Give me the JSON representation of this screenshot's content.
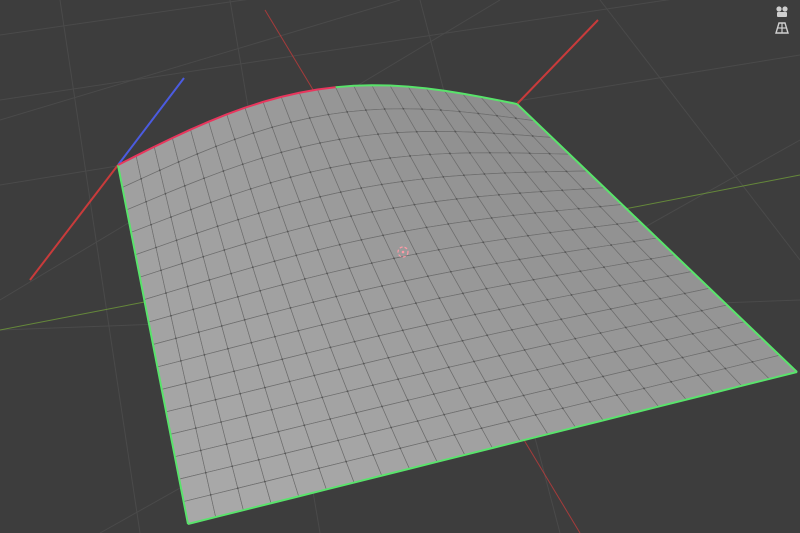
{
  "viewport": {
    "background": "#3d3d3d",
    "grid_color": "#4a4a4a",
    "axis_x_color": "#c83b3b",
    "axis_y_color": "#6f9b3a",
    "axis_z_color": "#4b5be0",
    "mesh_fill": "#9d9d9d",
    "mesh_wire": "#6e6e6e",
    "selected_edge_color": "#59e36b",
    "active_edge_color": "#e8365d",
    "pivot_color": "#ff9aa6"
  },
  "mesh": {
    "object_type": "plane",
    "subdivisions_u": 22,
    "subdivisions_v": 16,
    "selection_mode": "edge"
  },
  "navigation": {
    "icons": [
      "camera-view-icon",
      "perspective-icon"
    ]
  }
}
